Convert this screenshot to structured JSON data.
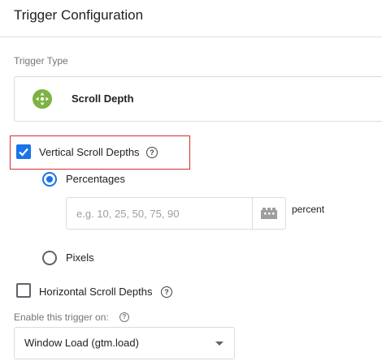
{
  "header": {
    "title": "Trigger Configuration"
  },
  "trigger_type": {
    "section_label": "Trigger Type",
    "name": "Scroll Depth",
    "icon": "scroll-depth-icon",
    "icon_color": "#7cb342"
  },
  "vertical": {
    "label": "Vertical Scroll Depths",
    "checked": true,
    "help_icon": "?",
    "options": [
      {
        "label": "Percentages",
        "selected": true
      },
      {
        "label": "Pixels",
        "selected": false
      }
    ],
    "input": {
      "placeholder": "e.g. 10, 25, 50, 75, 90",
      "value": "",
      "unit": "percent"
    }
  },
  "horizontal": {
    "label": "Horizontal Scroll Depths",
    "checked": false,
    "help_icon": "?"
  },
  "enable_on": {
    "label": "Enable this trigger on:",
    "help_icon": "?",
    "selected": "Window Load (gtm.load)"
  },
  "colors": {
    "accent": "#1a73e8",
    "highlight_border": "#d32f2f"
  }
}
